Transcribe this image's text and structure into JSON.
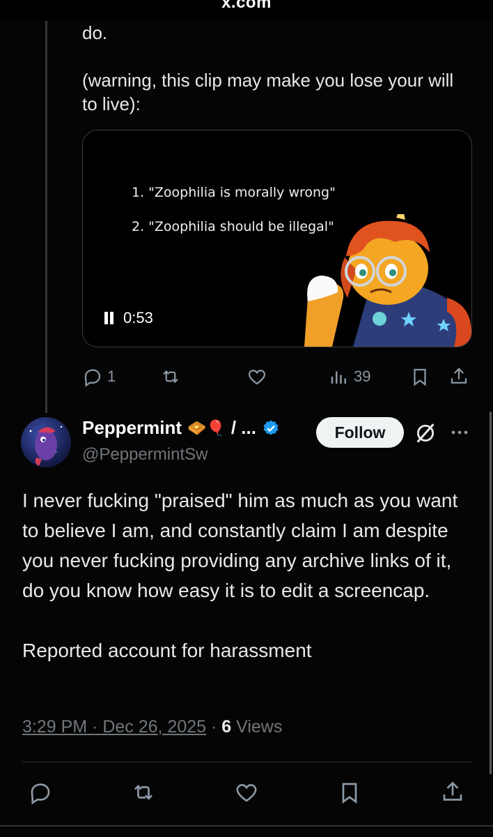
{
  "browser": {
    "url": "x.com"
  },
  "previous_tweet": {
    "text": "do.\n\n(warning, this clip may make you lose your will to live):",
    "video": {
      "list_items": [
        "1. \"Zoophilia is morally wrong\"",
        "2. \"Zoophilia should be illegal\""
      ],
      "time": "0:53"
    },
    "actions": {
      "replies": "1",
      "views": "39"
    }
  },
  "reply": {
    "display_name": "Peppermint",
    "name_emojis": "🧇🎈",
    "name_suffix": "/ ...",
    "handle": "@PeppermintSw",
    "follow_label": "Follow",
    "text": "I never fucking \"praised\" him as much as you want to believe I am, and constantly claim I am despite you never fucking providing any archive links of it, do you know how easy it is to edit a screencap.\n\nReported account for harassment",
    "timestamp": "3:29 PM · Dec 26, 2025",
    "views_count": "6",
    "views_label": "Views",
    "meta_sep": " · "
  },
  "colors": {
    "background": "#050505",
    "text": "#e7e9ea",
    "muted": "#71767b",
    "verified": "#1d9bf0"
  },
  "icons": [
    "pause-icon",
    "reply-icon",
    "retweet-icon",
    "like-icon",
    "views-icon",
    "bookmark-icon",
    "share-icon",
    "verified-icon",
    "grok-icon",
    "more-icon"
  ]
}
